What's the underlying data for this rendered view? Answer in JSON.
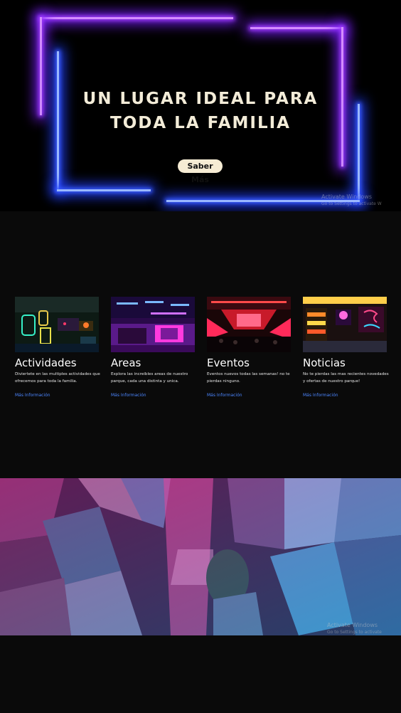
{
  "hero": {
    "title_line1": "UN LUGAR IDEAL PARA",
    "title_line2": "TODA LA FAMILIA",
    "button_label": "Saber Más",
    "watermark_title": "Activate Windows",
    "watermark_sub": "Go to Settings to activate W"
  },
  "cards": [
    {
      "title": "Actividades",
      "description": "Diviertete en las multiples actividades que ofrecemos para toda la familia.",
      "link": "Más Información",
      "image_icon": "arcade-photo"
    },
    {
      "title": "Areas",
      "description": "Explora las increibles areas de nuestro parque, cada una distinta y unica.",
      "link": "Más Información",
      "image_icon": "neon-bar-photo"
    },
    {
      "title": "Eventos",
      "description": "Eventos nuevos todas las semanas! no te pierdas ninguno.",
      "link": "Más Información",
      "image_icon": "concert-stage-photo"
    },
    {
      "title": "Noticias",
      "description": "No te pierdas las mas recientes novedades y ofertas de nuestro parque!",
      "link": "Más Información",
      "image_icon": "neon-street-photo"
    }
  ],
  "city": {
    "image_icon": "neon-city-aerial-photo",
    "watermark_title": "Activate Windows",
    "watermark_sub": "Go to Settings to activate Windows."
  },
  "colors": {
    "page_bg": "#0a0a0a",
    "neon_purple": "#a23cff",
    "neon_blue": "#3a5cff",
    "button_bg": "#f6ecd4",
    "link": "#4c86ff"
  }
}
